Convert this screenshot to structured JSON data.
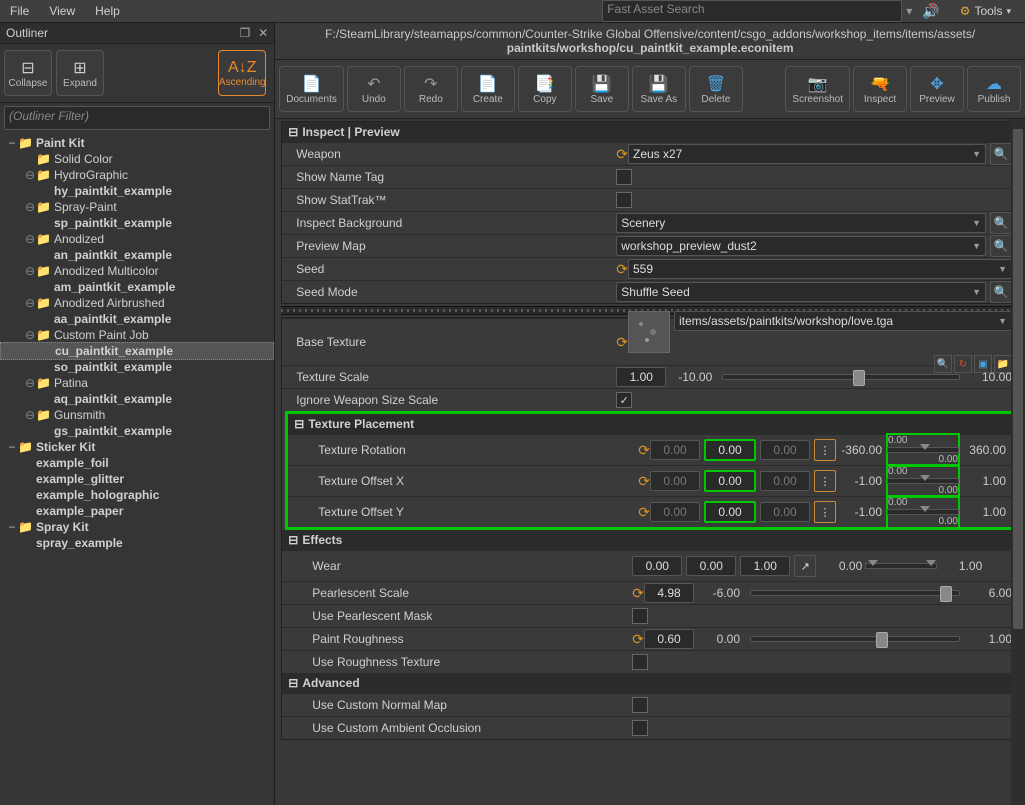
{
  "menu": {
    "file": "File",
    "view": "View",
    "help": "Help",
    "search_placeholder": "Fast Asset Search",
    "tools": "Tools"
  },
  "outliner": {
    "title": "Outliner",
    "collapse": "Collapse",
    "expand": "Expand",
    "sort": "Ascending",
    "filter_placeholder": "(Outliner Filter)",
    "tree": [
      {
        "d": 0,
        "t": "Paint Kit",
        "fld": 1,
        "tw": "−",
        "bold": 1
      },
      {
        "d": 1,
        "t": "Solid Color",
        "fld": 1,
        "tw": ""
      },
      {
        "d": 1,
        "t": "HydroGraphic",
        "fld": 1,
        "tw": "⊖"
      },
      {
        "d": 2,
        "t": "hy_paintkit_example",
        "bold": 1
      },
      {
        "d": 1,
        "t": "Spray-Paint",
        "fld": 1,
        "tw": "⊖"
      },
      {
        "d": 2,
        "t": "sp_paintkit_example",
        "bold": 1
      },
      {
        "d": 1,
        "t": "Anodized",
        "fld": 1,
        "tw": "⊖"
      },
      {
        "d": 2,
        "t": "an_paintkit_example",
        "bold": 1
      },
      {
        "d": 1,
        "t": "Anodized Multicolor",
        "fld": 1,
        "tw": "⊖"
      },
      {
        "d": 2,
        "t": "am_paintkit_example",
        "bold": 1
      },
      {
        "d": 1,
        "t": "Anodized Airbrushed",
        "fld": 1,
        "tw": "⊖"
      },
      {
        "d": 2,
        "t": "aa_paintkit_example",
        "bold": 1
      },
      {
        "d": 1,
        "t": "Custom Paint Job",
        "fld": 1,
        "tw": "⊖"
      },
      {
        "d": 2,
        "t": "cu_paintkit_example",
        "bold": 1,
        "sel": 1
      },
      {
        "d": 2,
        "t": "so_paintkit_example",
        "bold": 1
      },
      {
        "d": 1,
        "t": "Patina",
        "fld": 1,
        "tw": "⊖"
      },
      {
        "d": 2,
        "t": "aq_paintkit_example",
        "bold": 1
      },
      {
        "d": 1,
        "t": "Gunsmith",
        "fld": 1,
        "tw": "⊖"
      },
      {
        "d": 2,
        "t": "gs_paintkit_example",
        "bold": 1
      },
      {
        "d": 0,
        "t": "Sticker Kit",
        "fld": 1,
        "tw": "−",
        "bold": 1
      },
      {
        "d": 1,
        "t": "example_foil",
        "bold": 1
      },
      {
        "d": 1,
        "t": "example_glitter",
        "bold": 1
      },
      {
        "d": 1,
        "t": "example_holographic",
        "bold": 1
      },
      {
        "d": 1,
        "t": "example_paper",
        "bold": 1
      },
      {
        "d": 0,
        "t": "Spray Kit",
        "fld": 1,
        "tw": "−",
        "bold": 1
      },
      {
        "d": 1,
        "t": "spray_example",
        "bold": 1
      }
    ]
  },
  "path": {
    "line1": "F:/SteamLibrary/steamapps/common/Counter-Strike Global Offensive/content/csgo_addons/workshop_items/items/assets/",
    "line2": "paintkits/workshop/cu_paintkit_example.econitem"
  },
  "toolbar": {
    "documents": "Documents",
    "undo": "Undo",
    "redo": "Redo",
    "create": "Create",
    "copy": "Copy",
    "save": "Save",
    "saveas": "Save As",
    "delete": "Delete",
    "screenshot": "Screenshot",
    "inspect": "Inspect",
    "preview": "Preview",
    "publish": "Publish"
  },
  "inspect": {
    "title": "Inspect | Preview",
    "weapon_lbl": "Weapon",
    "weapon_val": "Zeus x27",
    "nametag": "Show Name Tag",
    "stattrak": "Show StatTrak™",
    "bg_lbl": "Inspect Background",
    "bg_val": "Scenery",
    "map_lbl": "Preview Map",
    "map_val": "workshop_preview_dust2",
    "seed_lbl": "Seed",
    "seed_val": "559",
    "seedmode_lbl": "Seed Mode",
    "seedmode_val": "Shuffle Seed"
  },
  "tex": {
    "base_lbl": "Base Texture",
    "base_val": "items/assets/paintkits/workshop/love.tga",
    "scale_lbl": "Texture Scale",
    "scale_val": "1.00",
    "scale_min": "-10.00",
    "scale_max": "10.00",
    "ignore_lbl": "Ignore Weapon Size Scale",
    "placement": "Texture Placement",
    "rot_lbl": "Texture Rotation",
    "rot_a": "0.00",
    "rot_b": "0.00",
    "rot_c": "0.00",
    "rot_min": "-360.00",
    "rot_max": "360.00",
    "rot_r0": "0.00",
    "rot_r1": "0.00",
    "offx_lbl": "Texture Offset X",
    "offx_a": "0.00",
    "offx_b": "0.00",
    "offx_c": "0.00",
    "offx_min": "-1.00",
    "offx_max": "1.00",
    "offx_r0": "0.00",
    "offx_r1": "0.00",
    "offy_lbl": "Texture Offset Y",
    "offy_a": "0.00",
    "offy_b": "0.00",
    "offy_c": "0.00",
    "offy_min": "-1.00",
    "offy_max": "1.00",
    "offy_r0": "0.00",
    "offy_r1": "0.00"
  },
  "fx": {
    "title": "Effects",
    "wear_lbl": "Wear",
    "wear_a": "0.00",
    "wear_b": "0.00",
    "wear_c": "1.00",
    "wear_min": "0.00",
    "wear_max": "1.00",
    "pearl_lbl": "Pearlescent Scale",
    "pearl_val": "4.98",
    "pearl_min": "-6.00",
    "pearl_max": "6.00",
    "pearlmask": "Use Pearlescent Mask",
    "rough_lbl": "Paint Roughness",
    "rough_val": "0.60",
    "rough_min": "0.00",
    "rough_max": "1.00",
    "roughtex": "Use Roughness Texture"
  },
  "adv": {
    "title": "Advanced",
    "normal": "Use Custom Normal Map",
    "ao": "Use Custom Ambient Occlusion"
  }
}
